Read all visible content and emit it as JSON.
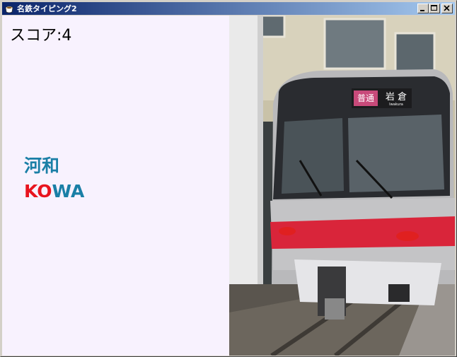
{
  "window": {
    "title": "名鉄タイピング2",
    "controls": [
      "minimize",
      "maximize",
      "close"
    ]
  },
  "game": {
    "score_label": "スコア:4",
    "station_kanji": "河和",
    "romaji_typed": "KO",
    "romaji_remaining": "WA"
  },
  "photo": {
    "destination_kanji": "岩 倉",
    "destination_romaji": "Iwakura",
    "service_type": "普通"
  },
  "colors": {
    "kanji": "#1a7fa6",
    "typed": "#e8141e",
    "remaining": "#1a7fa6",
    "pane_bg": "#f8f2fe",
    "train_stripe": "#d9253a"
  }
}
